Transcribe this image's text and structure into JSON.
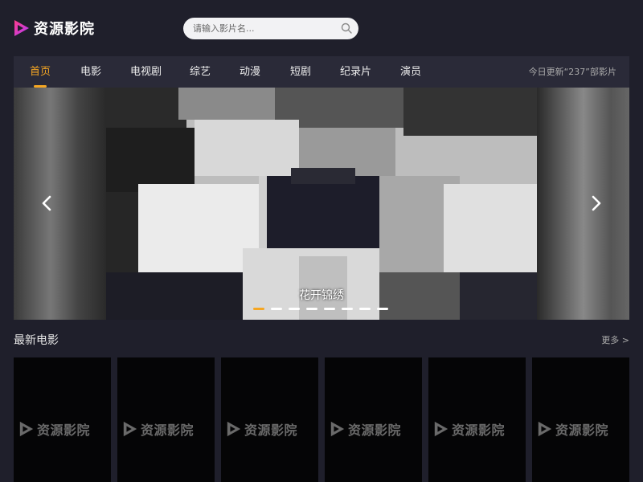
{
  "header": {
    "logo_text": "资源影院",
    "search_placeholder": "请输入影片名..."
  },
  "nav": {
    "items": [
      {
        "label": "首页",
        "active": true
      },
      {
        "label": "电影"
      },
      {
        "label": "电视剧"
      },
      {
        "label": "综艺"
      },
      {
        "label": "动漫"
      },
      {
        "label": "短剧"
      },
      {
        "label": "纪录片"
      },
      {
        "label": "演员"
      }
    ],
    "update_text": "今日更新“237”部影片"
  },
  "banner": {
    "title": "花开锦绣",
    "slide_count": 8,
    "active_slide": 1
  },
  "section": {
    "title": "最新电影",
    "more_label": "更多 >"
  },
  "cards": [
    {
      "logo_text": "资源影院"
    },
    {
      "logo_text": "资源影院"
    },
    {
      "logo_text": "资源影院"
    },
    {
      "logo_text": "资源影院"
    },
    {
      "logo_text": "资源影院"
    },
    {
      "logo_text": "资源影院"
    }
  ],
  "colors": {
    "accent": "#f5a623",
    "logo_gradient_start": "#ff3c8a",
    "logo_gradient_end": "#a23cff",
    "background": "#1f1f2b",
    "nav_background": "#2a2a38"
  }
}
